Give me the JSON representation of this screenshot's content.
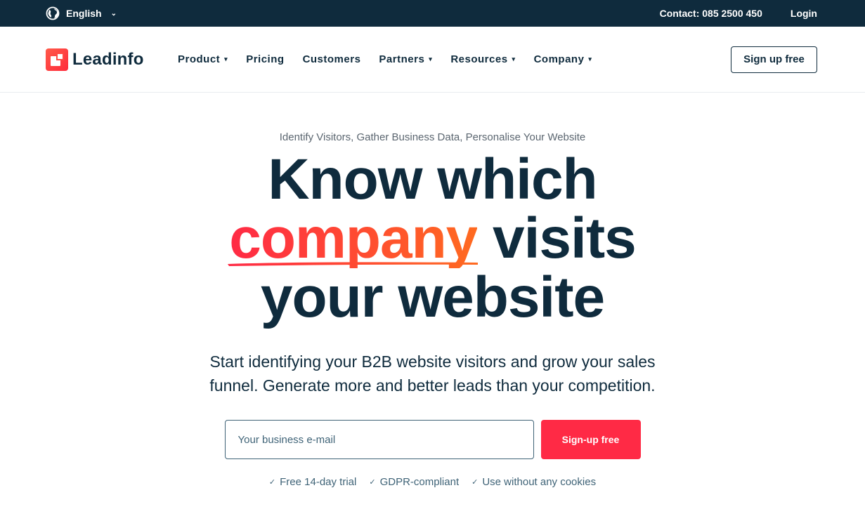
{
  "topbar": {
    "language": "English",
    "contact": "Contact: 085 2500 450",
    "login": "Login"
  },
  "nav": {
    "logo_text": "Leadinfo",
    "items": [
      {
        "label": "Product",
        "dropdown": true
      },
      {
        "label": "Pricing",
        "dropdown": false
      },
      {
        "label": "Customers",
        "dropdown": false
      },
      {
        "label": "Partners",
        "dropdown": true
      },
      {
        "label": "Resources",
        "dropdown": true
      },
      {
        "label": "Company",
        "dropdown": true
      }
    ],
    "cta": "Sign up free"
  },
  "hero": {
    "eyebrow": "Identify Visitors, Gather Business Data, Personalise Your Website",
    "headline_line1": "Know which",
    "headline_highlight": "company",
    "headline_line2_rest": " visits",
    "headline_line3": "your website",
    "subtitle_line1": "Start identifying your B2B website visitors and grow your sales",
    "subtitle_line2": "funnel. Generate more and better leads than your competition.",
    "email_placeholder": "Your business e-mail",
    "submit": "Sign-up free",
    "check_glyph": "✓",
    "checks": [
      "Free 14-day trial",
      "GDPR-compliant",
      "Use without any cookies"
    ]
  },
  "colors": {
    "navy": "#0f2b3d",
    "accent_red": "#ff2a45",
    "accent_orange": "#ff6a20"
  }
}
